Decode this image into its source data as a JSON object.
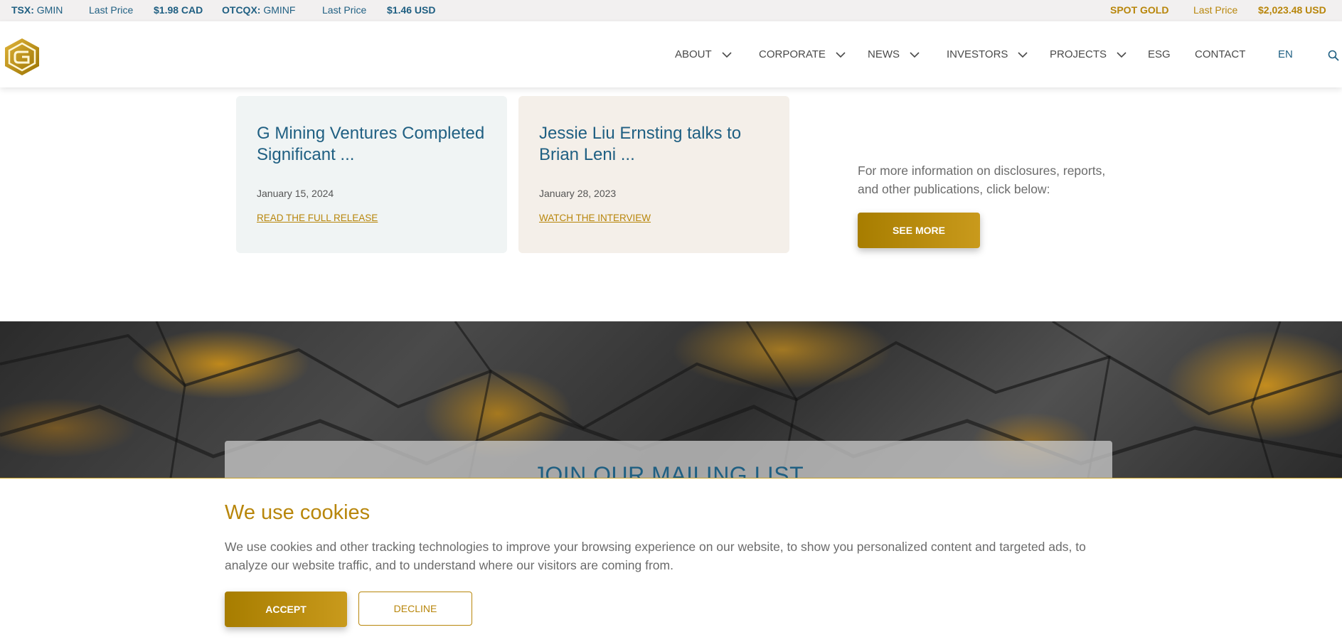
{
  "ticker": {
    "tsx_label": "TSX:",
    "tsx_symbol": "GMIN",
    "tsx_last_label": "Last Price",
    "tsx_price": "$1.98 CAD",
    "otc_label": "OTCQX:",
    "otc_symbol": "GMINF",
    "otc_last_label": "Last Price",
    "otc_price": "$1.46 USD",
    "gold_label": "SPOT GOLD",
    "gold_last_label": "Last Price",
    "gold_price": "$2,023.48 USD"
  },
  "nav": {
    "items": [
      {
        "label": "ABOUT"
      },
      {
        "label": "CORPORATE"
      },
      {
        "label": "NEWS"
      },
      {
        "label": "INVESTORS"
      },
      {
        "label": "PROJECTS"
      },
      {
        "label": "ESG"
      },
      {
        "label": "CONTACT"
      },
      {
        "label": "EN"
      }
    ]
  },
  "cards": [
    {
      "title": "G Mining Ventures Completed Significant ...",
      "date": "January 15, 2024",
      "link": "READ THE FULL RELEASE"
    },
    {
      "title": "Jessie Liu Ernsting talks to Brian Leni ...",
      "date": "January 28, 2023",
      "link": "WATCH THE INTERVIEW"
    }
  ],
  "more": {
    "text": "For more information on disclosures, reports, and other publications, click below:",
    "button": "SEE MORE"
  },
  "mailing": {
    "title": "JOIN OUR MAILING LIST"
  },
  "cookie": {
    "title": "We use cookies",
    "text": "We use cookies and other tracking technologies to improve your browsing experience on our website, to show you personalized content and targeted ads, to analyze our website traffic, and to understand where our visitors are coming from.",
    "accept": "ACCEPT",
    "decline": "DECLINE"
  },
  "colors": {
    "gold": "#b8860b",
    "blue": "#1f5f82"
  }
}
